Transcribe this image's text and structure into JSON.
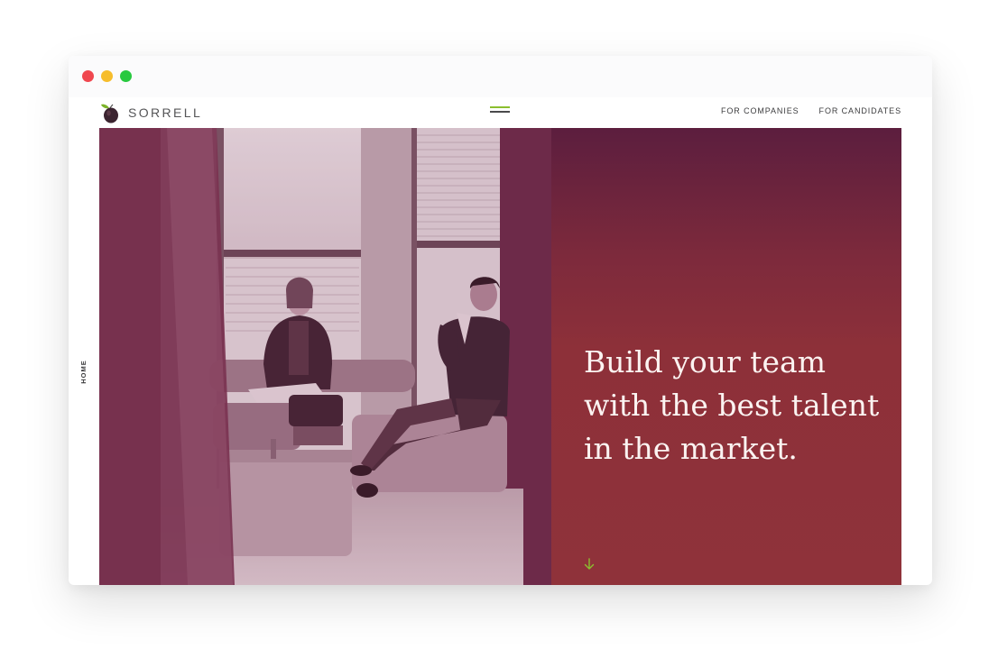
{
  "brand": {
    "name": "SORRELL"
  },
  "nav": {
    "items": [
      "FOR COMPANIES",
      "FOR CANDIDATES"
    ]
  },
  "sidebar": {
    "label": "HOME"
  },
  "hero": {
    "headline": "Build your team with the best talent in the market."
  },
  "colors": {
    "accent_green": "#8bbf2e",
    "panel_red": "#8f323a",
    "panel_top": "#5c1e3e",
    "photo_tint": "#7a3350"
  }
}
